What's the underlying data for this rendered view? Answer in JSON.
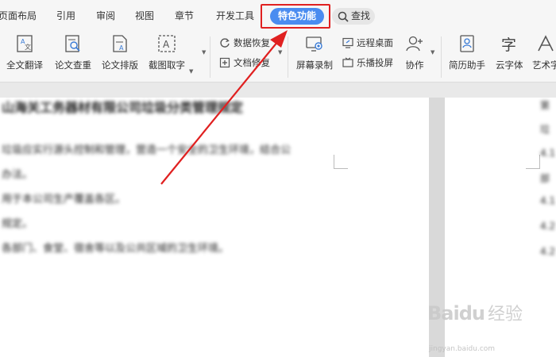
{
  "tabs": [
    {
      "label": "页面布局"
    },
    {
      "label": "引用"
    },
    {
      "label": "审阅"
    },
    {
      "label": "视图"
    },
    {
      "label": "章节"
    },
    {
      "label": "开发工具"
    },
    {
      "label": "特色功能"
    }
  ],
  "search": {
    "label": "查找"
  },
  "ribbon": {
    "full_translate": "全文翻译",
    "paper_check": "论文查重",
    "paper_layout": "论文排版",
    "screenshot_ocr": "截图取字",
    "data_recovery": "数据恢复",
    "doc_repair": "文档修复",
    "screen_record": "屏幕录制",
    "remote_desktop": "远程桌面",
    "cast_screen": "乐播投屏",
    "collaborate": "协作",
    "resume": "简历助手",
    "cloud_font": "云字体",
    "art_font": "艺术字"
  },
  "document": {
    "title": "山海关工务器材有限公司垃圾分类管理规定",
    "lines": [
      "垃圾应实行源头控制和管理，营造一个安全的卫生环境，结合公",
      "办法。",
      "用于本公司生产覆盖各区。",
      "规定。",
      "各部门、食堂、宿舍等以及公共区域的卫生环境。"
    ],
    "side_lines": [
      "第",
      "垃",
      "4.1",
      "部",
      "4.1",
      "4.2",
      "4.2"
    ]
  },
  "watermark": {
    "logo": "Baidu",
    "text": "经验",
    "url": "jingyan.baidu.com"
  },
  "colors": {
    "accent": "#4a8cf0",
    "annotation": "#e02020"
  }
}
